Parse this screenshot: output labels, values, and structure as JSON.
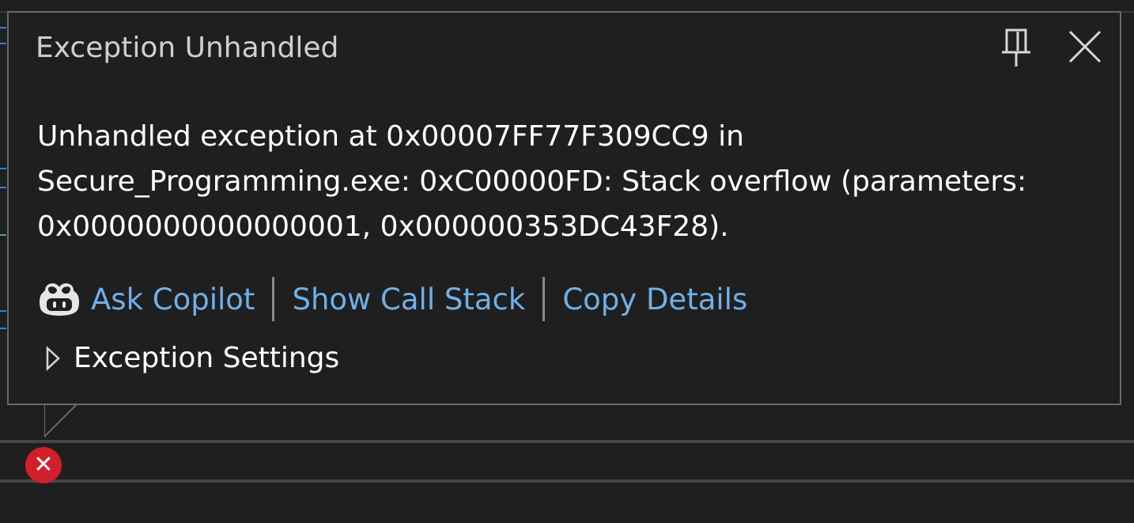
{
  "popup": {
    "title": "Exception Unhandled",
    "message": "Unhandled exception at 0x00007FF77F309CC9 in\nSecure_Programming.exe: 0xC00000FD: Stack overflow (parameters:\n0x0000000000000001, 0x000000353DC43F28).",
    "actions": {
      "ask_copilot": "Ask Copilot",
      "show_call_stack": "Show Call Stack",
      "copy_details": "Copy Details"
    },
    "exception_settings_label": "Exception Settings",
    "pin_icon": "pin-icon",
    "close_icon": "close-icon",
    "copilot_icon": "copilot-icon",
    "expander_icon": "chevron-right-icon"
  },
  "editor": {
    "error_glyph_icon": "error-x-icon"
  },
  "colors": {
    "background": "#1f1f1f",
    "popup_border": "#6a6a6a",
    "link": "#6fb0e8",
    "title_text": "#cfcfcf",
    "body_text": "#ffffff",
    "error_red": "#d1202b"
  }
}
